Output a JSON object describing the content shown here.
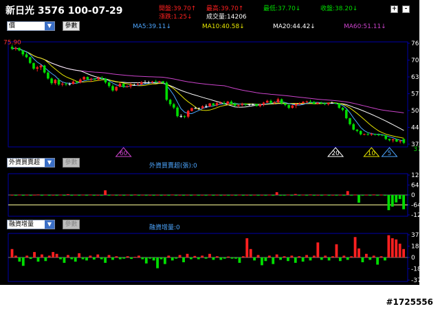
{
  "header": {
    "stock": "新日光 3576 100-07-29",
    "open": "開盤:39.70↑",
    "high": "最高:39.70↑",
    "low": "最低:37.70↓",
    "close": "收盤:38.20↓",
    "change": "漲跌:1.25↓",
    "volume": "成交量:14206"
  },
  "window_buttons": {
    "add": "+",
    "remove": "-"
  },
  "controls": {
    "price_select": "價",
    "param_button": "參數",
    "foreign_select": "外資買賣超",
    "margin_select": "融資增量"
  },
  "legend": {
    "ma5": "MA5:39.11↓",
    "ma10": "MA10:40.58↓",
    "ma20": "MA20:44.42↓",
    "ma60": "MA60:51.11↓"
  },
  "colors": {
    "up": "#ff2020",
    "down": "#00dd00",
    "ma5": "#4da6ff",
    "ma10": "#e6e600",
    "ma20": "#ffffff",
    "ma60": "#cc44cc",
    "axis": "#0000aa",
    "zero": "#ffff99"
  },
  "watermark": "#1725556",
  "chart_data": [
    {
      "type": "candlestick",
      "name": "price",
      "ylim": [
        37.7,
        76.59
      ],
      "y_ticks": [
        "76.59",
        "70.10",
        "63.62",
        "57.14",
        "50.66",
        "44.18",
        "37.70"
      ],
      "max_label": "75.90",
      "min_label": "37.70",
      "markers": [
        {
          "label": "60",
          "index": 31
        },
        {
          "label": "20",
          "index": 90
        },
        {
          "label": "10",
          "index": 100
        },
        {
          "label": "5",
          "index": 105
        }
      ],
      "candles": [
        [
          75.2,
          75.9,
          74.0,
          74.5
        ],
        [
          74.5,
          75.3,
          73.8,
          74.8
        ],
        [
          74.8,
          75.0,
          73.5,
          73.8
        ],
        [
          73.8,
          74.0,
          71.6,
          72.3
        ],
        [
          72.3,
          73.1,
          70.9,
          71.2
        ],
        [
          71.2,
          71.4,
          68.6,
          69.0
        ],
        [
          69.0,
          69.1,
          66.3,
          66.8
        ],
        [
          66.8,
          67.9,
          65.7,
          67.3
        ],
        [
          67.3,
          68.4,
          66.3,
          68.0
        ],
        [
          68.0,
          68.3,
          64.9,
          65.3
        ],
        [
          65.3,
          65.9,
          62.6,
          63.0
        ],
        [
          63.0,
          63.4,
          60.6,
          61.2
        ],
        [
          61.2,
          62.8,
          60.6,
          62.5
        ],
        [
          62.5,
          63.1,
          60.2,
          60.7
        ],
        [
          60.7,
          61.6,
          60.0,
          61.0
        ],
        [
          61.0,
          61.5,
          60.1,
          60.9
        ],
        [
          60.9,
          61.4,
          60.3,
          60.9
        ],
        [
          60.9,
          62.3,
          60.7,
          61.8
        ],
        [
          61.8,
          62.1,
          60.9,
          61.5
        ],
        [
          61.5,
          63.1,
          61.1,
          62.6
        ],
        [
          62.6,
          63.9,
          62.4,
          63.6
        ],
        [
          63.6,
          63.8,
          62.3,
          62.7
        ],
        [
          62.7,
          63.3,
          61.7,
          62.9
        ],
        [
          62.9,
          63.2,
          62.3,
          62.7
        ],
        [
          62.7,
          63.8,
          62.1,
          63.3
        ],
        [
          63.3,
          63.9,
          62.7,
          63.0
        ],
        [
          63.0,
          63.2,
          61.0,
          61.5
        ],
        [
          61.5,
          61.9,
          59.5,
          60.1
        ],
        [
          60.1,
          60.8,
          57.9,
          58.4
        ],
        [
          58.4,
          60.0,
          58.0,
          59.8
        ],
        [
          59.8,
          61.5,
          59.7,
          61.0
        ],
        [
          61.0,
          61.2,
          59.4,
          59.8
        ],
        [
          59.8,
          60.4,
          59.5,
          60.0
        ],
        [
          60.0,
          61.4,
          59.2,
          60.5
        ],
        [
          60.5,
          61.0,
          60.2,
          60.5
        ],
        [
          60.5,
          61.4,
          60.2,
          60.8
        ],
        [
          60.8,
          62.0,
          60.4,
          61.5
        ],
        [
          61.5,
          62.3,
          61.0,
          61.5
        ],
        [
          61.5,
          62.1,
          61.0,
          61.5
        ],
        [
          61.5,
          62.1,
          61.0,
          61.8
        ],
        [
          61.8,
          62.5,
          61.4,
          61.5
        ],
        [
          61.5,
          62.1,
          61.4,
          61.9
        ],
        [
          61.9,
          62.1,
          61.0,
          61.4
        ],
        [
          61.4,
          61.9,
          54.3,
          54.8
        ],
        [
          54.8,
          55.2,
          52.4,
          53.1
        ],
        [
          53.1,
          53.6,
          51.2,
          51.8
        ],
        [
          51.8,
          52.4,
          48.0,
          48.5
        ],
        [
          48.5,
          49.2,
          47.9,
          48.5
        ],
        [
          48.5,
          48.8,
          47.7,
          48.3
        ],
        [
          48.3,
          50.9,
          47.7,
          50.5
        ],
        [
          50.5,
          51.8,
          50.3,
          51.6
        ],
        [
          51.6,
          52.1,
          51.4,
          51.6
        ],
        [
          51.6,
          51.8,
          51.2,
          51.6
        ],
        [
          51.6,
          52.7,
          51.2,
          52.3
        ],
        [
          52.3,
          53.0,
          51.7,
          52.3
        ],
        [
          52.3,
          53.6,
          52.0,
          53.4
        ],
        [
          53.4,
          53.6,
          52.2,
          52.7
        ],
        [
          52.7,
          54.0,
          52.2,
          53.5
        ],
        [
          53.5,
          54.2,
          53.3,
          53.6
        ],
        [
          53.6,
          54.3,
          52.9,
          53.3
        ],
        [
          53.3,
          54.4,
          52.8,
          54.1
        ],
        [
          54.1,
          54.6,
          53.0,
          53.3
        ],
        [
          53.3,
          53.8,
          52.3,
          52.5
        ],
        [
          52.5,
          53.0,
          51.8,
          52.8
        ],
        [
          52.8,
          53.7,
          52.2,
          53.2
        ],
        [
          53.2,
          53.5,
          52.4,
          53.1
        ],
        [
          53.1,
          53.3,
          52.5,
          53.1
        ],
        [
          53.1,
          53.4,
          52.6,
          53.1
        ],
        [
          53.1,
          53.3,
          52.2,
          52.4
        ],
        [
          52.4,
          53.3,
          51.9,
          53.0
        ],
        [
          53.0,
          54.0,
          52.3,
          53.7
        ],
        [
          53.7,
          54.8,
          53.6,
          54.4
        ],
        [
          54.4,
          54.9,
          53.3,
          53.6
        ],
        [
          53.6,
          54.3,
          53.1,
          53.9
        ],
        [
          53.9,
          55.6,
          53.6,
          55.0
        ],
        [
          55.0,
          55.3,
          53.0,
          53.4
        ],
        [
          53.4,
          53.7,
          52.3,
          52.8
        ],
        [
          52.8,
          53.1,
          51.2,
          51.7
        ],
        [
          51.7,
          52.9,
          51.4,
          52.6
        ],
        [
          52.6,
          53.5,
          51.6,
          53.2
        ],
        [
          53.2,
          53.8,
          52.7,
          53.5
        ],
        [
          53.5,
          54.3,
          53.3,
          54.0
        ],
        [
          54.0,
          54.5,
          53.6,
          54.1
        ],
        [
          54.1,
          54.8,
          53.7,
          54.0
        ],
        [
          54.0,
          54.3,
          53.0,
          53.2
        ],
        [
          53.2,
          53.9,
          53.0,
          53.7
        ],
        [
          53.7,
          54.1,
          53.1,
          53.4
        ],
        [
          53.4,
          53.9,
          52.7,
          53.1
        ],
        [
          53.1,
          53.8,
          52.6,
          53.6
        ],
        [
          53.6,
          54.1,
          53.3,
          53.6
        ],
        [
          53.6,
          53.8,
          53.1,
          53.4
        ],
        [
          53.4,
          53.6,
          51.3,
          51.7
        ],
        [
          51.7,
          52.1,
          50.4,
          50.9
        ],
        [
          50.9,
          51.3,
          47.3,
          47.7
        ],
        [
          47.7,
          47.9,
          44.9,
          45.4
        ],
        [
          45.4,
          45.9,
          43.0,
          43.3
        ],
        [
          43.3,
          43.5,
          42.3,
          42.8
        ],
        [
          42.8,
          43.0,
          41.1,
          41.5
        ],
        [
          41.5,
          41.8,
          41.1,
          41.6
        ],
        [
          41.6,
          42.3,
          41.0,
          41.5
        ],
        [
          41.5,
          42.1,
          40.9,
          41.6
        ],
        [
          41.6,
          41.8,
          41.0,
          41.4
        ],
        [
          41.4,
          41.8,
          40.8,
          41.3
        ],
        [
          41.3,
          41.4,
          40.8,
          41.1
        ],
        [
          41.1,
          41.2,
          39.3,
          39.7
        ],
        [
          39.7,
          39.8,
          38.8,
          39.2
        ],
        [
          39.2,
          39.8,
          38.4,
          39.6
        ],
        [
          39.6,
          39.8,
          38.5,
          38.7
        ],
        [
          38.7,
          39.4,
          38.0,
          38.9
        ],
        [
          39.7,
          39.7,
          37.7,
          38.2
        ]
      ]
    },
    {
      "type": "bar",
      "name": "外資買賣超(張)",
      "title": "外資買賣超(張):0",
      "ylim": [
        -12836,
        12836
      ],
      "y_ticks": [
        "12836",
        "6418",
        "0",
        "-6418",
        "-12836"
      ],
      "reference_line": -6418,
      "values": [
        120,
        -180,
        240,
        -300,
        180,
        -120,
        150,
        300,
        -250,
        200,
        -150,
        100,
        -80,
        220,
        -300,
        500,
        -200,
        150,
        -100,
        200,
        -400,
        250,
        -150,
        100,
        -200,
        3000,
        -300,
        150,
        -200,
        120,
        -100,
        200,
        -150,
        300,
        -250,
        150,
        -120,
        100,
        -80,
        150,
        -200,
        120,
        -100,
        250,
        -150,
        100,
        -200,
        150,
        -300,
        200,
        -100,
        120,
        -150,
        200,
        -100,
        150,
        -200,
        100,
        -150,
        120,
        -100,
        200,
        -150,
        100,
        -120,
        150,
        -200,
        120,
        -100,
        200,
        -80,
        1800,
        -250,
        -300,
        250,
        -150,
        600,
        -100,
        200,
        -150,
        300,
        -120,
        100,
        -180,
        250,
        -150,
        100,
        -200,
        150,
        -120,
        2500,
        -300,
        250,
        -5000,
        -400,
        150,
        -200,
        300,
        -150,
        200,
        -100,
        -9800,
        -7500,
        -4800,
        -2600,
        -9200
      ]
    },
    {
      "type": "bar",
      "name": "融資增量",
      "title": "融資增量:0",
      "ylim": [
        -3777,
        3777
      ],
      "y_ticks": [
        "3777",
        "1888",
        "0",
        "-1888",
        "-3777"
      ],
      "values": [
        1400,
        300,
        -700,
        -1400,
        300,
        -250,
        900,
        -700,
        500,
        -600,
        300,
        900,
        600,
        -300,
        -900,
        400,
        -300,
        -700,
        700,
        -300,
        -500,
        300,
        -350,
        500,
        -300,
        -900,
        400,
        -400,
        200,
        -300,
        -200,
        200,
        -250,
        100,
        300,
        -300,
        -1000,
        -200,
        -500,
        -1800,
        -300,
        -1100,
        300,
        -500,
        -200,
        400,
        -800,
        600,
        -300,
        250,
        -300,
        300,
        -200,
        600,
        -400,
        200,
        -400,
        -200,
        150,
        -200,
        -200,
        -900,
        200,
        3200,
        1400,
        -500,
        400,
        -1300,
        -600,
        300,
        -1100,
        500,
        -400,
        200,
        -600,
        300,
        -900,
        200,
        -700,
        400,
        -500,
        300,
        2500,
        -400,
        300,
        -500,
        200,
        2200,
        -600,
        300,
        -400,
        200,
        3400,
        1500,
        -800,
        600,
        -400,
        300,
        -1200,
        200,
        -500,
        3700,
        3200,
        3000,
        2300,
        1400
      ]
    }
  ]
}
